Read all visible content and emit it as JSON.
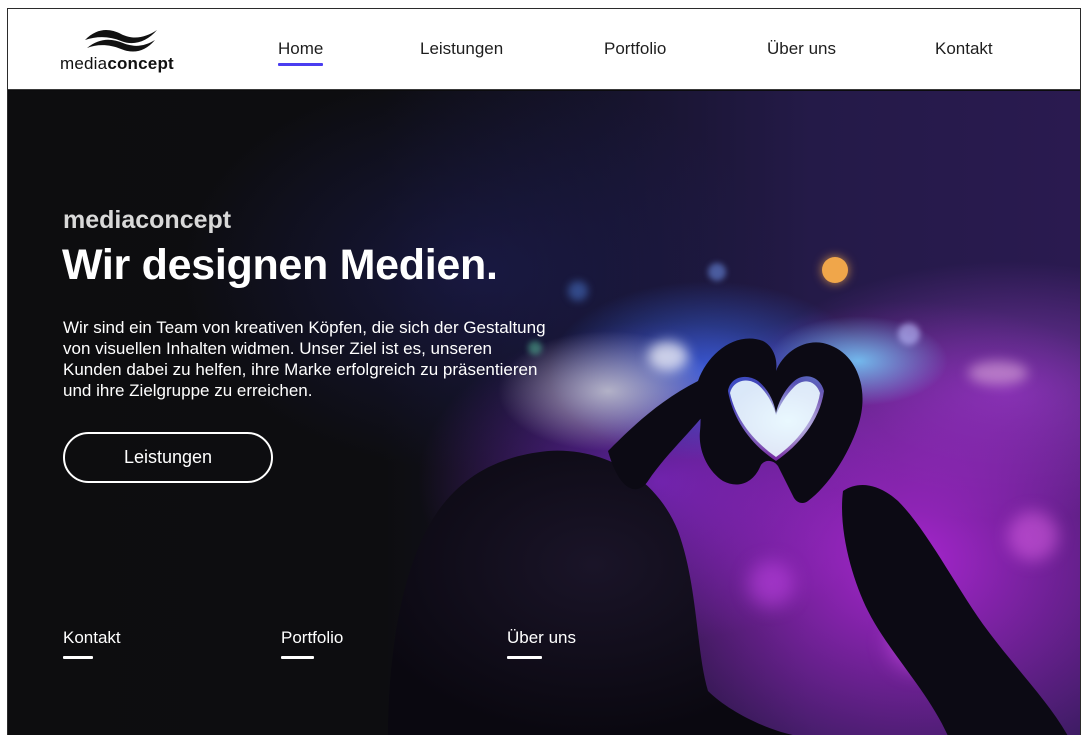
{
  "logo": {
    "text_light": "media",
    "text_bold": "concept",
    "icon": "wave-logo-icon"
  },
  "nav": {
    "items": [
      {
        "label": "Home",
        "active": true
      },
      {
        "label": "Leistungen",
        "active": false
      },
      {
        "label": "Portfolio",
        "active": false
      },
      {
        "label": "Über uns",
        "active": false
      },
      {
        "label": "Kontakt",
        "active": false
      }
    ],
    "accent_color": "#4a3df0"
  },
  "hero": {
    "eyebrow": "mediaconcept",
    "title": "Wir designen Medien.",
    "text_lines": [
      "Wir sind ein Team von kreativen Köpfen, die sich der Gestaltung",
      "von visuellen Inhalten widmen. Unser Ziel ist es, unseren",
      "Kunden dabei zu helfen, ihre Marke erfolgreich zu präsentieren",
      "und ihre Zielgruppe zu erreichen."
    ],
    "cta_label": "Leistungen",
    "background_image": "concert-crowd-heart-hands-image"
  },
  "footer_links": [
    {
      "label": "Kontakt"
    },
    {
      "label": "Portfolio"
    },
    {
      "label": "Über uns"
    }
  ]
}
